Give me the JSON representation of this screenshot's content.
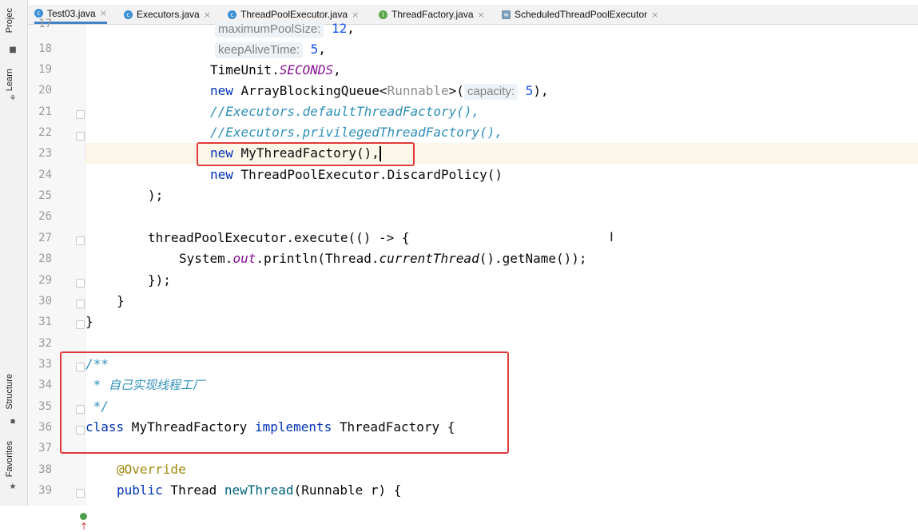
{
  "tool_window_tabs": [
    "Projec",
    "Learn",
    "Structure",
    "Favorites"
  ],
  "tabs": [
    {
      "label": "Test03.java",
      "icon": "java-class-icon"
    },
    {
      "label": "Executors.java",
      "icon": "java-class-icon"
    },
    {
      "label": "ThreadPoolExecutor.java",
      "icon": "java-class-icon"
    },
    {
      "label": "ThreadFactory.java",
      "icon": "java-interface-icon"
    },
    {
      "label": "ScheduledThreadPoolExecutor",
      "icon": "class-file-icon"
    }
  ],
  "close_glyph": "×",
  "line_numbers": [
    "17",
    "18",
    "19",
    "20",
    "21",
    "22",
    "23",
    "24",
    "25",
    "26",
    "27",
    "28",
    "29",
    "30",
    "31",
    "32",
    "33",
    "34",
    "35",
    "36",
    "37",
    "38",
    "39"
  ],
  "code": {
    "l17_hint": "maximumPoolSize:",
    "l17_val": "12",
    "l18_hint": "keepAliveTime:",
    "l18_val": "5",
    "l19_a": "TimeUnit.",
    "l19_b": "SECONDS",
    "l20_a": "new",
    "l20_b": " ArrayBlockingQueue<",
    "l20_c": "Runnable",
    "l20_d": ">(",
    "l20_hint": "capacity:",
    "l20_val": "5",
    "l21": "//Executors.defaultThreadFactory(),",
    "l22": "//Executors.privilegedThreadFactory(),",
    "l23_a": "new",
    "l23_b": " MyThreadFactory(),",
    "l24_a": "new",
    "l24_b": " ThreadPoolExecutor.DiscardPolicy()",
    "l25": ");",
    "l27_a": "threadPoolExecutor.execute(() -> {",
    "l28_a": "System.",
    "l28_b": "out",
    "l28_c": ".println(Thread.",
    "l28_d": "currentThread",
    "l28_e": "().getName());",
    "l29": "});",
    "l30": "}",
    "l31": "}",
    "l33": "/**",
    "l34_a": " * ",
    "l34_b": "自己实现线程工厂",
    "l35": " */",
    "l36_a": "class",
    "l36_b": " MyThreadFactory ",
    "l36_c": "implements",
    "l36_d": " ThreadFactory {",
    "l38": "@Override",
    "l39_a": "public",
    "l39_b": " Thread ",
    "l39_c": "newThread",
    "l39_d": "(Runnable r) {"
  },
  "colors": {
    "keyword": "#0033b3",
    "comment": "#8c8c8c",
    "highlight_box": "#e03a3a"
  }
}
